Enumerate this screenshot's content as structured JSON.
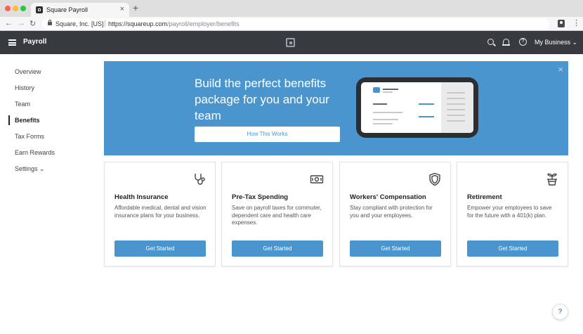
{
  "browser": {
    "tab_title": "Square Payroll",
    "tab_close": "×",
    "new_tab": "+",
    "back": "←",
    "forward": "→",
    "reload": "↻",
    "url_org": "Square, Inc. [US]",
    "url_separator": "|",
    "url_host": "https://squareup.com",
    "url_path": "/payroll/employer/benefits",
    "menu": "⋮"
  },
  "header": {
    "title": "Payroll",
    "business_menu": "My Business ⌄",
    "help": "?"
  },
  "sidebar": {
    "items": [
      {
        "label": "Overview"
      },
      {
        "label": "History"
      },
      {
        "label": "Team"
      },
      {
        "label": "Benefits"
      },
      {
        "label": "Tax Forms"
      },
      {
        "label": "Earn Rewards"
      },
      {
        "label": "Settings ⌄"
      }
    ],
    "active_index": 3
  },
  "banner": {
    "title": "Build the perfect benefits package for you and your team",
    "button": "How This Works",
    "close": "×"
  },
  "cards": [
    {
      "icon": "stethoscope-icon",
      "title": "Health Insurance",
      "description": "Affordable medical, dental and vision insurance plans for your business.",
      "button": "Get Started"
    },
    {
      "icon": "money-bill-icon",
      "title": "Pre-Tax Spending",
      "description": "Save on payroll taxes for commuter, dependent care and health care expenses.",
      "button": "Get Started"
    },
    {
      "icon": "shield-icon",
      "title": "Workers' Compensation",
      "description": "Stay compliant with protection for you and your employees.",
      "button": "Get Started"
    },
    {
      "icon": "plant-icon",
      "title": "Retirement",
      "description": "Empower your employees to save for the future with a 401(k) plan.",
      "button": "Get Started"
    }
  ],
  "help_fab": "?",
  "colors": {
    "accent": "#4b95cf",
    "header_bg": "#373b40"
  }
}
